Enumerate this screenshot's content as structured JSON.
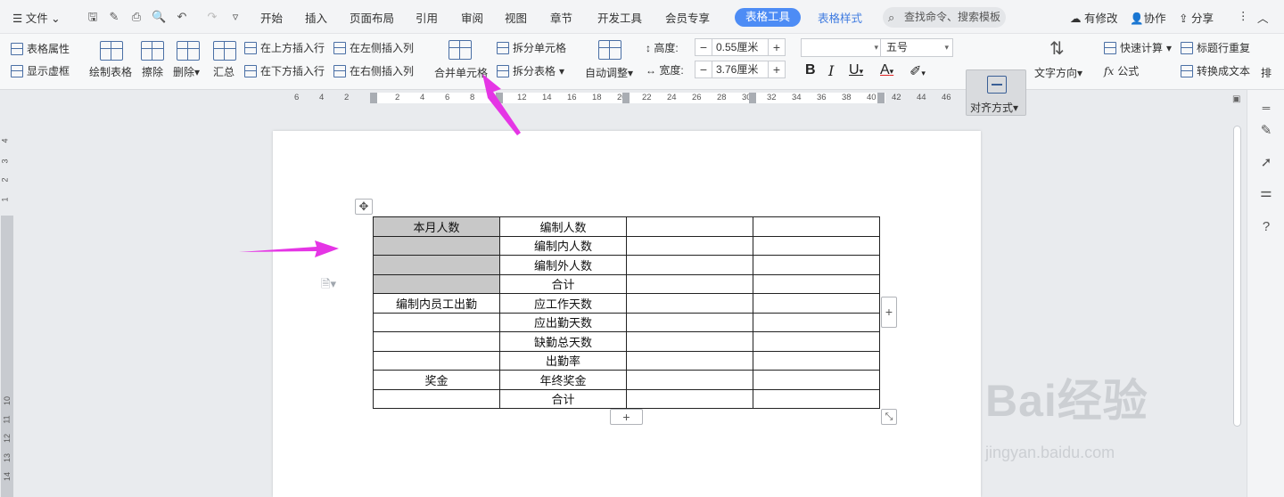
{
  "menubar": {
    "file_label": "文件",
    "tabs": [
      "开始",
      "插入",
      "页面布局",
      "引用",
      "审阅",
      "视图",
      "章节",
      "开发工具",
      "会员专享"
    ],
    "active_tab": "表格工具",
    "style_tab": "表格样式",
    "search_placeholder": "查找命令、搜索模板",
    "right": {
      "modified": "有修改",
      "collab": "协作",
      "share": "分享"
    }
  },
  "ribbon": {
    "table_props": "表格属性",
    "show_gridlines": "显示虚框",
    "draw_table": "绘制表格",
    "erase": "擦除",
    "delete": "删除",
    "summary": "汇总",
    "insert_above": "在上方插入行",
    "insert_below": "在下方插入行",
    "insert_left": "在左侧插入列",
    "insert_right": "在右侧插入列",
    "merge_cells": "合并单元格",
    "split_cells": "拆分单元格",
    "split_table": "拆分表格",
    "auto_adjust": "自动调整",
    "height_label": "高度:",
    "height_value": "0.55厘米",
    "width_label": "宽度:",
    "width_value": "3.76厘米",
    "font_name": "",
    "font_size": "五号",
    "align": "对齐方式",
    "text_dir": "文字方向",
    "quick_calc": "快速计算",
    "formula": "公式",
    "repeat_header": "标题行重复",
    "to_text": "转换成文本",
    "sort": "排"
  },
  "ruler": {
    "h_ticks": [
      "6",
      "4",
      "2",
      "2",
      "4",
      "6",
      "8",
      "10",
      "12",
      "14",
      "16",
      "18",
      "20",
      "22",
      "24",
      "26",
      "28",
      "30",
      "32",
      "34",
      "36",
      "38",
      "40",
      "42",
      "44",
      "46"
    ],
    "v_ticks": [
      "4",
      "3",
      "2",
      "1",
      "10",
      "11",
      "12",
      "13",
      "14",
      "15"
    ]
  },
  "table": {
    "rows": [
      [
        "本月人数",
        "编制人数",
        "",
        ""
      ],
      [
        "",
        "编制内人数",
        "",
        ""
      ],
      [
        "",
        "编制外人数",
        "",
        ""
      ],
      [
        "",
        "合计",
        "",
        ""
      ],
      [
        "编制内员工出勤",
        "应工作天数",
        "",
        ""
      ],
      [
        "",
        "应出勤天数",
        "",
        ""
      ],
      [
        "",
        "缺勤总天数",
        "",
        ""
      ],
      [
        "",
        "出勤率",
        "",
        ""
      ],
      [
        "奖金",
        "年终奖金",
        "",
        ""
      ],
      [
        "",
        "合计",
        "",
        ""
      ]
    ],
    "selected_rows": [
      0,
      1,
      2,
      3
    ]
  },
  "watermark": {
    "logo": "Bai经验",
    "url": "jingyan.baidu.com"
  },
  "colors": {
    "accent": "#4d8cf5",
    "arrow": "#e535e5",
    "selection": "#c8c8c8"
  }
}
